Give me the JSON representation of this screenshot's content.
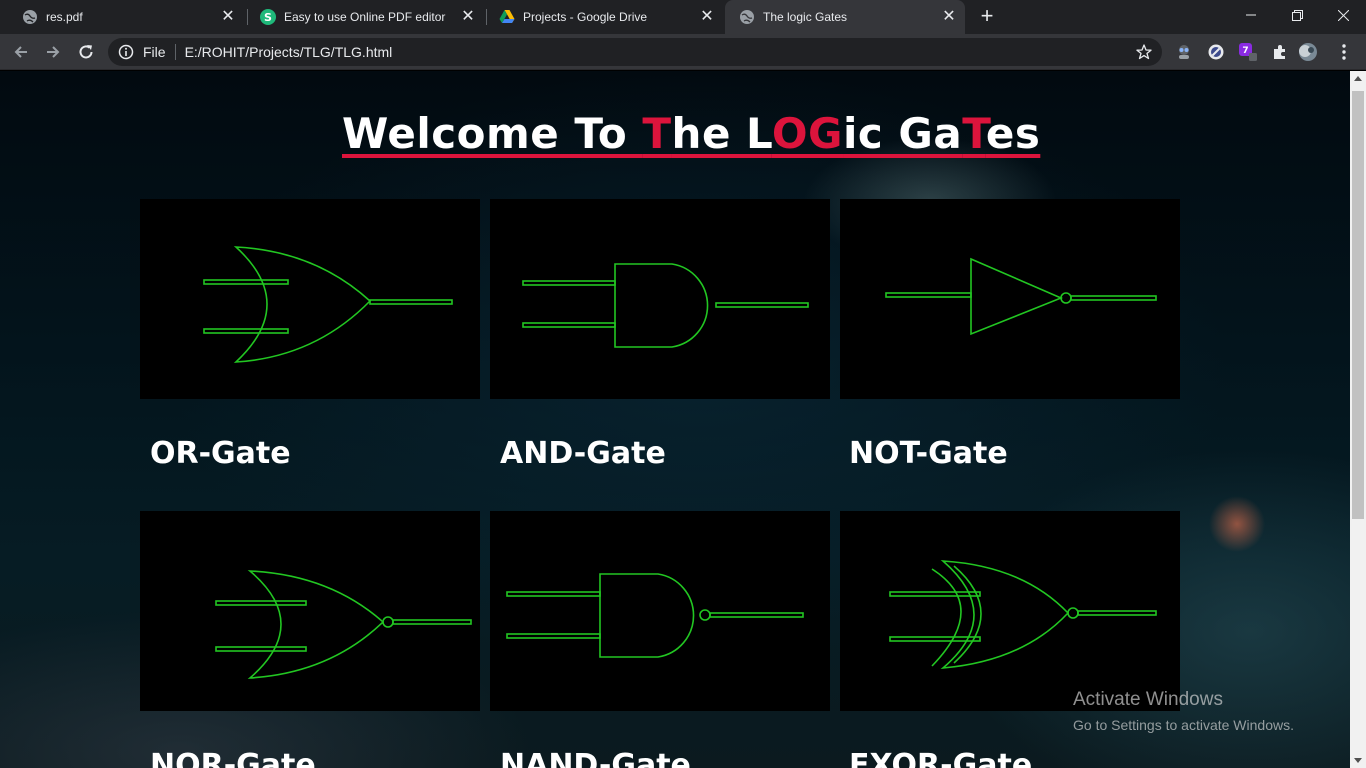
{
  "tabs": [
    {
      "title": "res.pdf",
      "icon": "globe-icon",
      "active": false
    },
    {
      "title": "Easy to use Online PDF editor",
      "icon": "sejda-icon",
      "active": false
    },
    {
      "title": "Projects - Google Drive",
      "icon": "google-drive-icon",
      "active": false
    },
    {
      "title": "The logic Gates",
      "icon": "globe-icon",
      "active": true
    }
  ],
  "address_bar": {
    "scheme": "File",
    "url": "E:/ROHIT/Projects/TLG/TLG.html"
  },
  "page": {
    "heading_parts": [
      {
        "text": "Welcome To ",
        "red": false
      },
      {
        "text": "T",
        "red": true
      },
      {
        "text": "he L",
        "red": false
      },
      {
        "text": "OG",
        "red": true
      },
      {
        "text": "ic Ga",
        "red": false
      },
      {
        "text": "T",
        "red": true
      },
      {
        "text": "es",
        "red": false
      }
    ],
    "gates": [
      {
        "label": "OR-Gate",
        "symbol": "or"
      },
      {
        "label": "AND-Gate",
        "symbol": "and"
      },
      {
        "label": "NOT-Gate",
        "symbol": "not"
      },
      {
        "label": "NOR-Gate",
        "symbol": "nor"
      },
      {
        "label": "NAND-Gate",
        "symbol": "nand"
      },
      {
        "label": "EXOR-Gate",
        "symbol": "xor"
      }
    ]
  },
  "watermark": {
    "line1": "Activate Windows",
    "line2": "Go to Settings to activate Windows."
  },
  "colors": {
    "accent_red": "#dc143c",
    "gate_stroke": "#22c622",
    "chrome_dark": "#202124",
    "chrome_light": "#35363a"
  }
}
